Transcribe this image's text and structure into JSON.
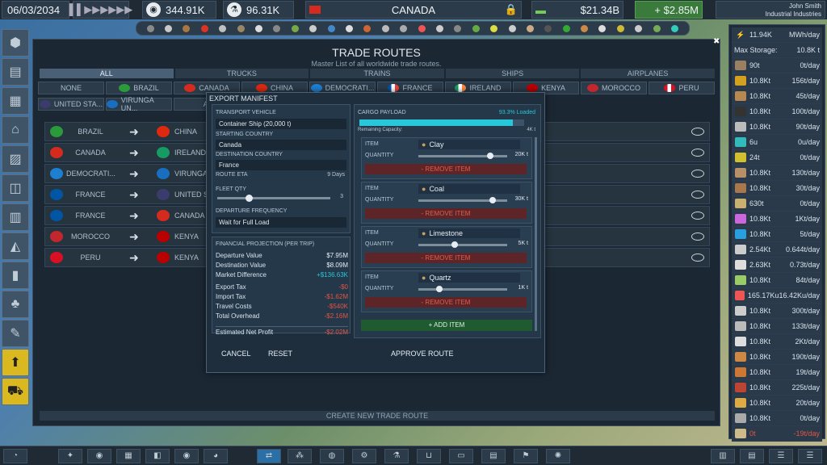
{
  "topbar": {
    "date": "06/03/2034",
    "population": "344.91K",
    "research": "96.31K",
    "country": "CANADA",
    "money": "$21.34B",
    "income": "+ $2.85M",
    "user_name": "John Smith",
    "company": "Industrial Industries"
  },
  "power": {
    "value": "11.94K",
    "unit": "MWh/day",
    "storage_label": "Max Storage:",
    "storage_value": "10.8K t"
  },
  "resources": [
    {
      "qty": "90t",
      "rate": "0t/day"
    },
    {
      "qty": "10.8Kt",
      "rate": "156t/day"
    },
    {
      "qty": "10.8Kt",
      "rate": "45t/day"
    },
    {
      "qty": "10.8Kt",
      "rate": "100t/day"
    },
    {
      "qty": "10.8Kt",
      "rate": "90t/day"
    },
    {
      "qty": "6u",
      "rate": "0u/day"
    },
    {
      "qty": "24t",
      "rate": "0t/day"
    },
    {
      "qty": "10.8Kt",
      "rate": "130t/day"
    },
    {
      "qty": "10.8Kt",
      "rate": "30t/day"
    },
    {
      "qty": "630t",
      "rate": "0t/day"
    },
    {
      "qty": "10.8Kt",
      "rate": "1Kt/day"
    },
    {
      "qty": "10.8Kt",
      "rate": "5t/day"
    },
    {
      "qty": "2.54Kt",
      "rate": "0.644t/day"
    },
    {
      "qty": "2.63Kt",
      "rate": "0.73t/day"
    },
    {
      "qty": "10.8Kt",
      "rate": "84t/day"
    },
    {
      "qty": "165.17Ku",
      "rate": "16.42Ku/day"
    },
    {
      "qty": "10.8Kt",
      "rate": "300t/day"
    },
    {
      "qty": "10.8Kt",
      "rate": "133t/day"
    },
    {
      "qty": "10.8Kt",
      "rate": "2Kt/day"
    },
    {
      "qty": "10.8Kt",
      "rate": "190t/day"
    },
    {
      "qty": "10.8Kt",
      "rate": "19t/day"
    },
    {
      "qty": "10.8Kt",
      "rate": "225t/day"
    },
    {
      "qty": "10.8Kt",
      "rate": "20t/day"
    },
    {
      "qty": "10.8Kt",
      "rate": "0t/day"
    },
    {
      "qty": "0t",
      "rate": "-19t/day"
    }
  ],
  "main": {
    "title": "TRADE ROUTES",
    "subtitle": "Master List of all worldwide trade routes.",
    "tabs": [
      "ALL",
      "TRUCKS",
      "TRAINS",
      "SHIPS",
      "AIRPLANES"
    ],
    "filters_row1": [
      "NONE",
      "BRAZIL",
      "CANADA",
      "CHINA",
      "DEMOCRATI...",
      "FRANCE",
      "IRELAND",
      "KENYA",
      "MOROCCO",
      "PERU"
    ],
    "filters_row2": [
      "UNITED STA...",
      "VIRUNGA UN...",
      "AI"
    ],
    "routes": [
      {
        "from": "BRAZIL",
        "to": "CHINA"
      },
      {
        "from": "CANADA",
        "to": "IRELAND"
      },
      {
        "from": "DEMOCRATI...",
        "to": "VIRUNGA UN"
      },
      {
        "from": "FRANCE",
        "to": "UNITED ST"
      },
      {
        "from": "FRANCE",
        "to": "CANADA"
      },
      {
        "from": "MOROCCO",
        "to": "KENYA"
      },
      {
        "from": "PERU",
        "to": "KENYA"
      }
    ],
    "create_label": "CREATE NEW TRADE ROUTE"
  },
  "manifest": {
    "title": "EXPORT MANIFEST",
    "vehicle_label": "TRANSPORT VEHICLE",
    "vehicle": "Container Ship (20,000 t)",
    "start_label": "STARTING COUNTRY",
    "start": "Canada",
    "dest_label": "DESTINATION COUNTRY",
    "dest": "France",
    "eta_label": "ROUTE ETA",
    "eta": "9 Days",
    "fleet_label": "FLEET QTY",
    "fleet": "3",
    "fleet_level": 0.25,
    "freq_label": "DEPARTURE FREQUENCY",
    "freq": "Wait for Full Load",
    "fin_title": "FINANCIAL PROJECTION (PER TRIP)",
    "fin": [
      {
        "label": "Departure Value",
        "value": "$7.95M",
        "cls": ""
      },
      {
        "label": "Destination Value",
        "value": "$8.09M",
        "cls": ""
      },
      {
        "label": "Market Difference",
        "value": "+$136.63K",
        "cls": "cyan"
      },
      {
        "label": "Export Tax",
        "value": "-$0",
        "cls": "red"
      },
      {
        "label": "Import Tax",
        "value": "-$1.62M",
        "cls": "red"
      },
      {
        "label": "Travel Costs",
        "value": "-$540K",
        "cls": "red"
      },
      {
        "label": "Total Overhead",
        "value": "-$2.16M",
        "cls": "red"
      },
      {
        "label": "Estimated Net Profit",
        "value": "-$2.02M",
        "cls": "red"
      }
    ],
    "cargo_label": "CARGO PAYLOAD",
    "loaded": "93.3% Loaded",
    "remaining_label": "Remaining Capacity:",
    "remaining": "4K t",
    "item_label": "ITEM",
    "qty_label": "QUANTITY",
    "remove_label": "- REMOVE ITEM",
    "items": [
      {
        "name": "Clay",
        "qty": "20K t",
        "level": 0.77
      },
      {
        "name": "Coal",
        "qty": "30K t",
        "level": 0.8
      },
      {
        "name": "Limestone",
        "qty": "5K t",
        "level": 0.37
      },
      {
        "name": "Quartz",
        "qty": "1K t",
        "level": 0.2
      }
    ],
    "add_label": "+ ADD ITEM",
    "cancel": "CANCEL",
    "reset": "RESET",
    "approve": "APPROVE ROUTE"
  }
}
